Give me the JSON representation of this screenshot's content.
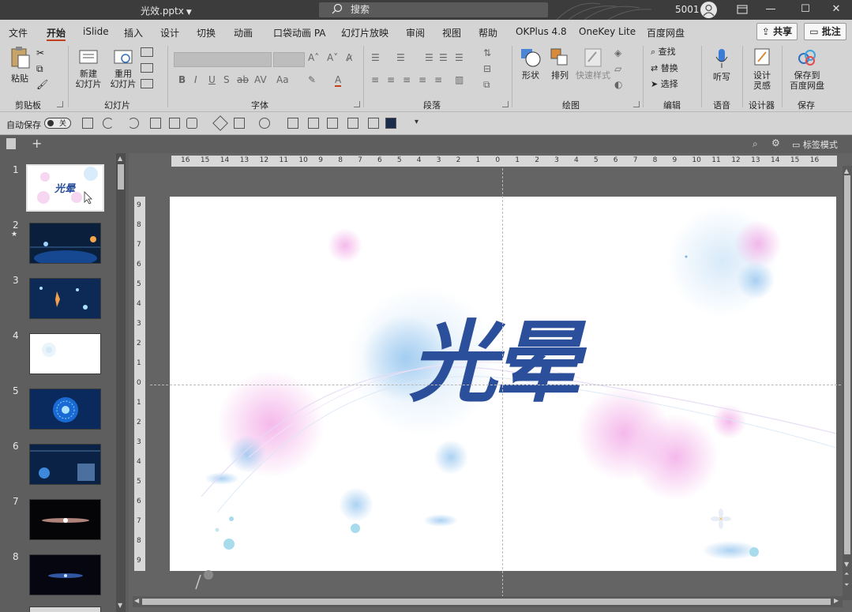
{
  "titlebar": {
    "filename": "光效.pptx",
    "search_placeholder": "搜索",
    "user_id": "5001"
  },
  "tabs": [
    "文件",
    "开始",
    "iSlide",
    "插入",
    "设计",
    "切换",
    "动画",
    "口袋动画 PA",
    "幻灯片放映",
    "审阅",
    "视图",
    "帮助",
    "OKPlus 4.8",
    "OneKey Lite",
    "百度网盘"
  ],
  "active_tab": "开始",
  "share_label": "共享",
  "comment_label": "批注",
  "ribbon": {
    "paste": "粘贴",
    "new_slide": [
      "新建",
      "幻灯片"
    ],
    "reuse_slide": [
      "重用",
      "幻灯片"
    ],
    "shape": "形状",
    "arrange": "排列",
    "quick_style": "快速样式",
    "find": "查找",
    "replace": "替换",
    "select": "选择",
    "dictate": "听写",
    "designer": [
      "设计",
      "灵感"
    ],
    "save_to_baidu": [
      "保存到",
      "百度网盘"
    ],
    "groups": {
      "clipboard": "剪贴板",
      "slides": "幻灯片",
      "font": "字体",
      "paragraph": "段落",
      "drawing": "绘图",
      "editing": "编辑",
      "voice": "语音",
      "designer": "设计器",
      "save": "保存"
    }
  },
  "qat": {
    "autosave": "自动保存",
    "toggle_state": "关"
  },
  "subbar": {
    "tag_mode": "标签模式"
  },
  "slides": [
    "1",
    "2",
    "3",
    "4",
    "5",
    "6",
    "7",
    "8"
  ],
  "slide_content": {
    "title": "光晕"
  },
  "rulers": {
    "horizontal": [
      "16",
      "15",
      "14",
      "13",
      "12",
      "11",
      "10",
      "9",
      "8",
      "7",
      "6",
      "5",
      "4",
      "3",
      "2",
      "1",
      "0",
      "1",
      "2",
      "3",
      "4",
      "5",
      "6",
      "7",
      "8",
      "9",
      "10",
      "11",
      "12",
      "13",
      "14",
      "15",
      "16"
    ],
    "vertical": [
      "9",
      "8",
      "7",
      "6",
      "5",
      "4",
      "3",
      "2",
      "1",
      "0",
      "1",
      "2",
      "3",
      "4",
      "5",
      "6",
      "7",
      "8",
      "9"
    ]
  },
  "colors": {
    "accent_tab": "#c43e1c",
    "title_text": "#2b4f9a",
    "titlebar_bg": "#3c3c3c",
    "ribbon_bg": "#d4d4d4"
  }
}
